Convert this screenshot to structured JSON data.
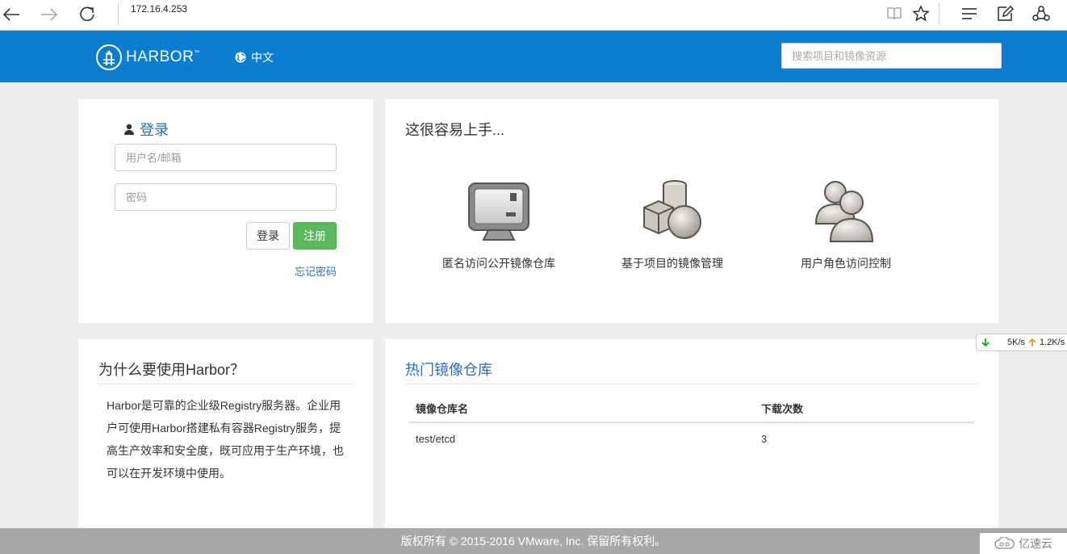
{
  "browser": {
    "address": "172.16.4.253",
    "nav_icons": [
      "back-icon",
      "forward-icon",
      "refresh-icon"
    ],
    "toolbar_icons": [
      "reading-view-icon",
      "favorite-star-icon",
      "hub-icon",
      "web-note-icon",
      "share-icon"
    ]
  },
  "header": {
    "logo_text": "HARBOR",
    "logo_tm": "™",
    "language": "中文",
    "search_placeholder": "搜索项目和镜像资源",
    "bg_color": "#0b7dd0"
  },
  "login": {
    "title": "登录",
    "username_placeholder": "用户名/邮箱",
    "password_placeholder": "密码",
    "login_button": "登录",
    "register_button": "注册",
    "forgot_password": "忘记密码"
  },
  "getting_started": {
    "title": "这很容易上手...",
    "features": [
      {
        "label": "匿名访问公开镜像仓库",
        "icon": "monitor-icon"
      },
      {
        "label": "基于项目的镜像管理",
        "icon": "shapes-icon"
      },
      {
        "label": "用户角色访问控制",
        "icon": "users-icon"
      }
    ]
  },
  "why": {
    "title": "为什么要使用Harbor？",
    "text": "Harbor是可靠的企业级Registry服务器。企业用户可使用Harbor搭建私有容器Registry服务，提高生产效率和安全度，既可应用于生产环境，也可以在开发环境中使用。"
  },
  "popular": {
    "title": "热门镜像仓库",
    "columns": [
      "镜像仓库名",
      "下载次数"
    ],
    "rows": [
      [
        "test/etcd",
        "3"
      ]
    ]
  },
  "footer": {
    "text": "版权所有 © 2015-2016 VMware, Inc. 保留所有权利。"
  },
  "speed_widget": {
    "down": "5K/s",
    "up": "1.2K/s"
  },
  "watermark": {
    "text": "亿速云"
  }
}
